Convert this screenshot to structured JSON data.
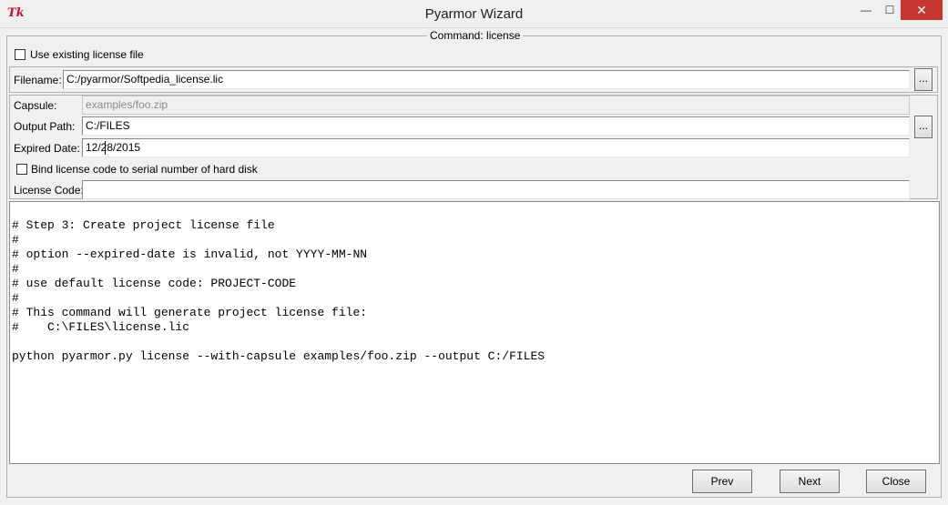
{
  "window": {
    "title": "Pyarmor Wizard",
    "app_icon": "Tk",
    "controls": {
      "minimize": "—",
      "maximize": "☐",
      "close": "✕"
    }
  },
  "frame": {
    "legend": "Command: license"
  },
  "use_existing": {
    "label": "Use existing license file",
    "checked": false
  },
  "filename": {
    "label": "Filename:",
    "value": "C:/pyarmor/Softpedia_license.lic",
    "browse": "..."
  },
  "capsule": {
    "label": "Capsule:",
    "value": "examples/foo.zip"
  },
  "output_path": {
    "label": "Output Path:",
    "value": "C:/FILES",
    "browse": "..."
  },
  "expired_date": {
    "label": "Expired Date:",
    "value": "12/28/2015"
  },
  "bind_hdd": {
    "label": "Bind license code to serial number of hard disk",
    "checked": false
  },
  "license_code": {
    "label": "License Code:",
    "value": ""
  },
  "console": {
    "lines": [
      "# Step 3: Create project license file",
      "#",
      "# option --expired-date is invalid, not YYYY-MM-NN",
      "#",
      "# use default license code: PROJECT-CODE",
      "#",
      "# This command will generate project license file:",
      "#    C:\\FILES\\license.lic",
      "",
      "python pyarmor.py license --with-capsule examples/foo.zip --output C:/FILES"
    ]
  },
  "buttons": {
    "prev": "Prev",
    "next": "Next",
    "close": "Close"
  }
}
